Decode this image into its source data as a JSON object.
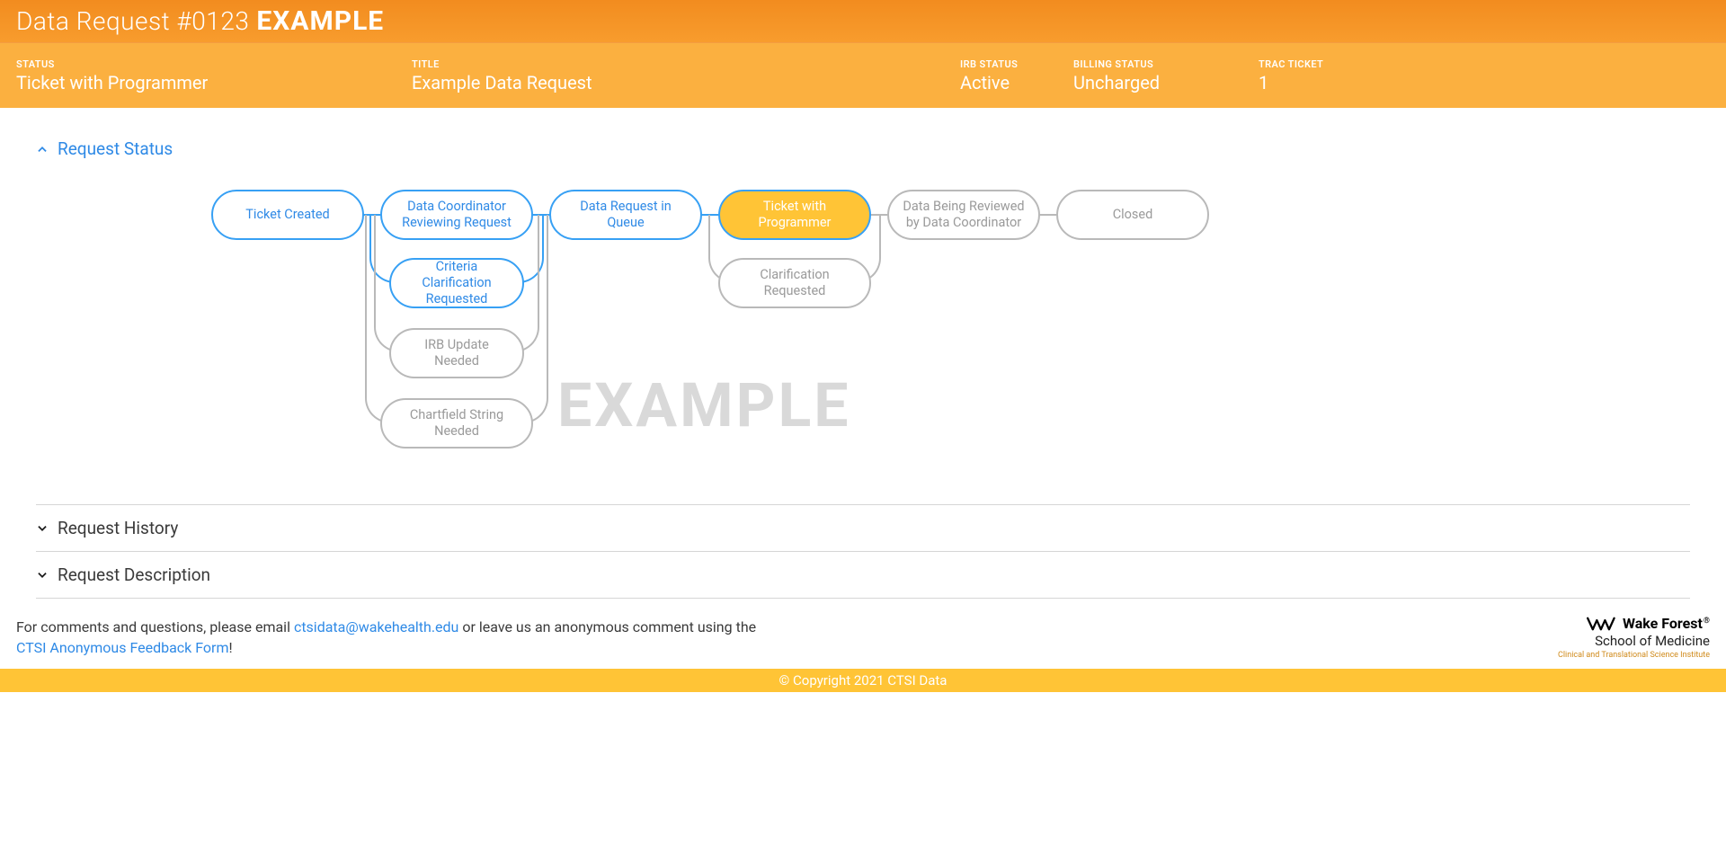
{
  "header": {
    "title": "Data Request #0123",
    "example_tag": "EXAMPLE"
  },
  "info": {
    "status_label": "STATUS",
    "status_value": "Ticket with Programmer",
    "title_label": "TITLE",
    "title_value": "Example Data Request",
    "irb_status_label": "IRB STATUS",
    "irb_status_value": "Active",
    "billing_status_label": "BILLING STATUS",
    "billing_status_value": "Uncharged",
    "trac_ticket_label": "TRAC TICKET",
    "trac_ticket_value": "1"
  },
  "sections": {
    "request_status": "Request Status",
    "request_history": "Request History",
    "request_description": "Request Description"
  },
  "workflow": {
    "ticket_created": "Ticket Created",
    "data_coordinator_reviewing": "Data Coordinator Reviewing Request",
    "criteria_clarification": "Criteria Clarification Requested",
    "irb_update_needed": "IRB Update Needed",
    "chartfield_string_needed": "Chartfield String Needed",
    "data_request_in_queue": "Data Request in Queue",
    "ticket_with_programmer": "Ticket with Programmer",
    "clarification_requested": "Clarification Requested",
    "data_being_reviewed": "Data Being Reviewed by Data Coordinator",
    "closed": "Closed",
    "watermark": "EXAMPLE"
  },
  "footer": {
    "text_prefix": "For comments and questions, please email ",
    "email": "ctsidata@wakehealth.edu",
    "text_middle": " or leave us an anonymous comment using the ",
    "form_link": "CTSI Anonymous Feedback Form",
    "text_suffix": "!",
    "brand_name": "Wake Forest",
    "brand_sub": "School of Medicine",
    "brand_tag": "Clinical and Translational Science Institute",
    "copyright": "© Copyright 2021 CTSI Data"
  }
}
